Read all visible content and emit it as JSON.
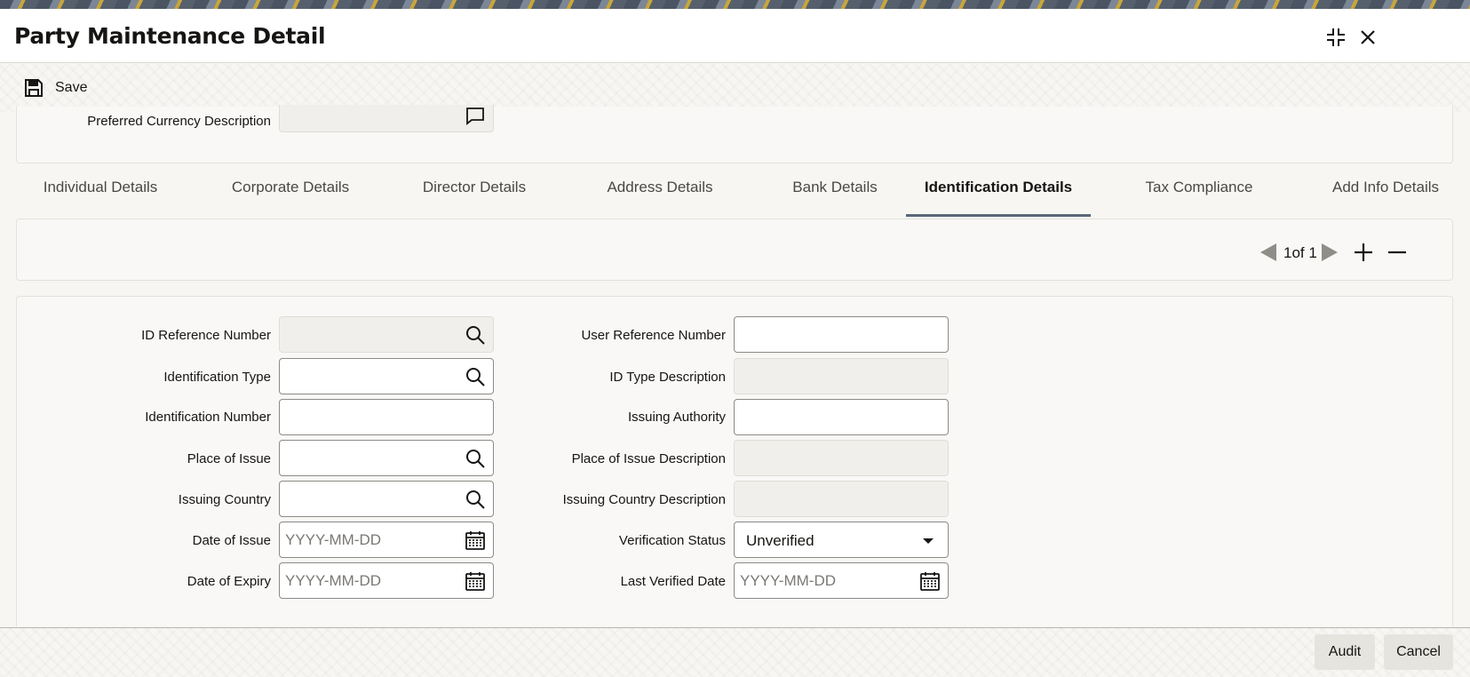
{
  "window": {
    "title": "Party Maintenance Detail",
    "maximize_icon": "maximize-icon",
    "close_icon": "close-icon"
  },
  "toolbar": {
    "save_label": "Save",
    "save_icon": "floppy-disk-icon"
  },
  "top_panel": {
    "preferred_currency_description_label": "Preferred Currency Description",
    "preferred_currency_description_value": ""
  },
  "tabs": [
    {
      "label": "Individual Details",
      "active": false
    },
    {
      "label": "Corporate Details",
      "active": false
    },
    {
      "label": "Director Details",
      "active": false
    },
    {
      "label": "Address Details",
      "active": false
    },
    {
      "label": "Bank Details",
      "active": false
    },
    {
      "label": "Identification Details",
      "active": true
    },
    {
      "label": "Tax Compliance",
      "active": false
    },
    {
      "label": "Add Info Details",
      "active": false
    }
  ],
  "pager": {
    "current": "1",
    "of_label": "of",
    "total": "1"
  },
  "form": {
    "id_reference_number": {
      "label": "ID Reference Number",
      "value": ""
    },
    "identification_type": {
      "label": "Identification Type",
      "value": ""
    },
    "identification_number": {
      "label": "Identification Number",
      "value": ""
    },
    "place_of_issue": {
      "label": "Place of Issue",
      "value": ""
    },
    "issuing_country": {
      "label": "Issuing Country",
      "value": ""
    },
    "date_of_issue": {
      "label": "Date of Issue",
      "placeholder": "YYYY-MM-DD"
    },
    "date_of_expiry": {
      "label": "Date of Expiry",
      "placeholder": "YYYY-MM-DD"
    },
    "user_reference_number": {
      "label": "User Reference Number",
      "value": ""
    },
    "id_type_description": {
      "label": "ID Type Description",
      "value": ""
    },
    "issuing_authority": {
      "label": "Issuing Authority",
      "value": ""
    },
    "place_of_issue_description": {
      "label": "Place of Issue Description",
      "value": ""
    },
    "issuing_country_description": {
      "label": "Issuing Country Description",
      "value": ""
    },
    "verification_status": {
      "label": "Verification Status",
      "value": "Unverified"
    },
    "last_verified_date": {
      "label": "Last Verified Date",
      "placeholder": "YYYY-MM-DD"
    }
  },
  "footer": {
    "audit_label": "Audit",
    "cancel_label": "Cancel"
  },
  "colors": {
    "active_tab_underline": "#5a6779",
    "panel_background": "#f9f8f6",
    "readonly_field": "#f1efeb"
  }
}
